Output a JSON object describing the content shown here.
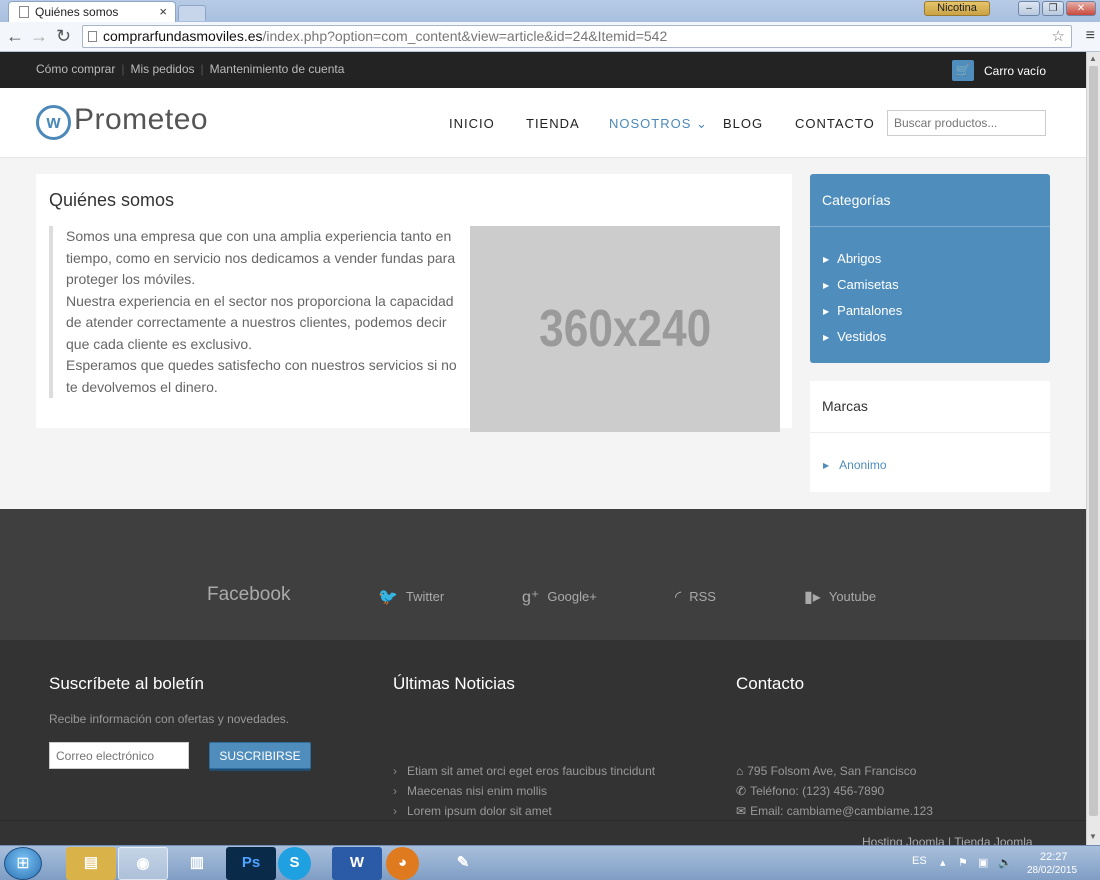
{
  "browser": {
    "tab_title": "Quiénes somos",
    "tab_close": "×",
    "user_badge": "Nicotina",
    "url_host": "comprarfundasmoviles.es",
    "url_path": "/index.php?option=com_content&view=article&id=24&Itemid=542"
  },
  "topbar": {
    "links": [
      "Cómo comprar",
      "Mis pedidos",
      "Mantenimiento de cuenta"
    ],
    "cart_label": "Carro vacío"
  },
  "header": {
    "logo_text": "Prometeo",
    "menu": [
      "INICIO",
      "TIENDA",
      "NOSOTROS",
      "BLOG",
      "CONTACTO"
    ],
    "search_placeholder": "Buscar productos..."
  },
  "article": {
    "title": "Quiénes somos",
    "lines": [
      "Somos una empresa que con una amplia experiencia tanto en",
      "tiempo, como en servicio nos dedicamos a vender fundas para",
      "proteger los móviles.",
      "Nuestra  experiencia en el sector nos proporciona la capacidad",
      "de atender correctamente a nuestros clientes, podemos decir",
      "que cada cliente es exclusivo.",
      "Esperamos que quedes satisfecho con nuestros servicios si no",
      "te devolvemos el dinero."
    ],
    "image_label": "360x240"
  },
  "sidebar": {
    "categories_title": "Categorías",
    "categories": [
      "Abrigos",
      "Camisetas",
      "Pantalones",
      "Vestidos"
    ],
    "brands_title": "Marcas",
    "brands": [
      "Anonimo"
    ]
  },
  "social": {
    "facebook": "Facebook",
    "twitter": "Twitter",
    "google": "Google+",
    "rss": "RSS",
    "youtube": "Youtube"
  },
  "footer": {
    "newsletter_title": "Suscríbete al boletín",
    "newsletter_desc": "Recibe información con ofertas y novedades.",
    "email_placeholder": "Correo electrónico",
    "subscribe_label": "SUSCRIBIRSE",
    "news_title": "Últimas Noticias",
    "news": [
      "Etiam sit amet orci eget eros faucibus tincidunt",
      "Maecenas nisi enim mollis",
      "Lorem ipsum dolor sit amet"
    ],
    "contact_title": "Contacto",
    "address": "795 Folsom Ave, San Francisco",
    "phone": "Teléfono: (123) 456-7890",
    "email": "Email: cambiame@cambiame.123",
    "credits": "Hosting Joomla | Tienda Joomla"
  },
  "taskbar": {
    "lang": "ES",
    "time": "22:27",
    "date": "28/02/2015"
  },
  "colors": {
    "accent": "#4f8dbd",
    "topbar": "#232323",
    "social_band": "#3f3f3f",
    "footer": "#333333"
  }
}
